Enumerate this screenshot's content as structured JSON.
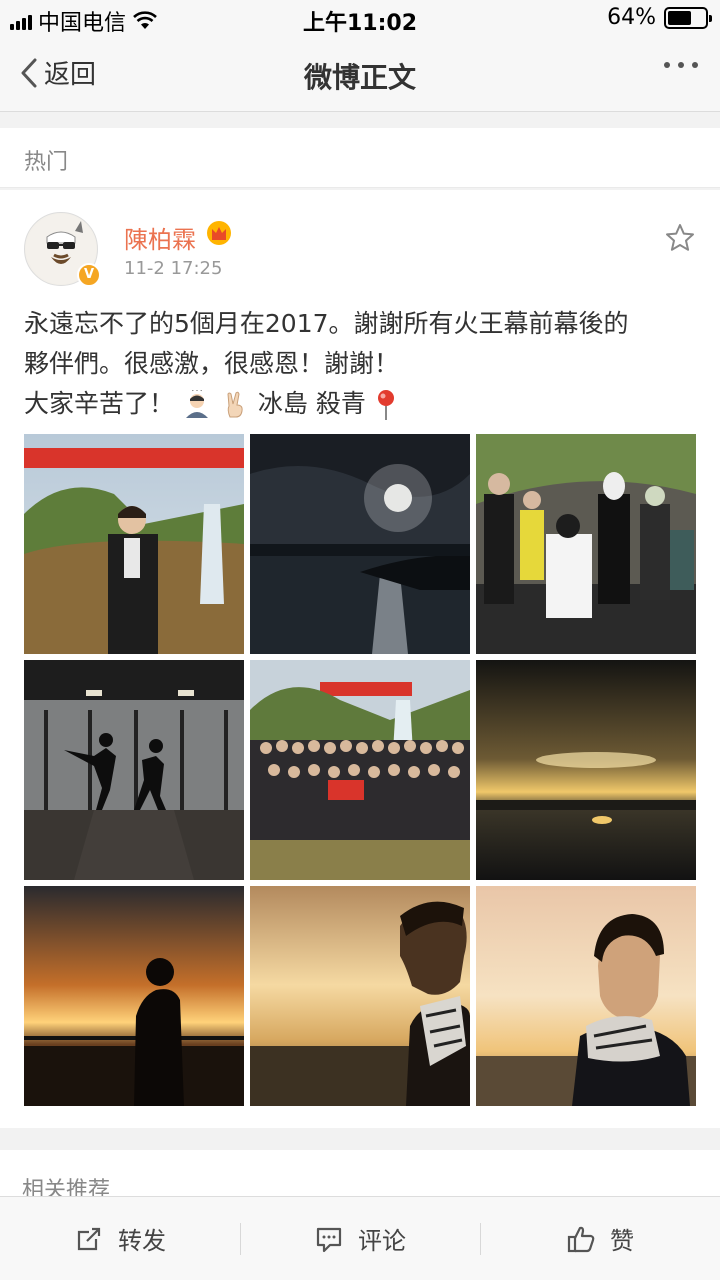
{
  "status": {
    "carrier": "中国电信",
    "time": "上午11:02",
    "battery": "64%",
    "battery_level": 0.64
  },
  "nav": {
    "back_label": "返回",
    "title": "微博正文"
  },
  "hot_label": "热门",
  "post": {
    "username": "陳柏霖",
    "time": "11-2 17:25",
    "text_line1": "永遠忘不了的5個月在2017。謝謝所有火王幕前幕後的",
    "text_line2": "夥伴們。很感激，很感恩！謝謝！",
    "text_line3_a": "大家辛苦了！",
    "text_line3_b": "冰島 殺青",
    "photos": [
      "photo-banner-waterfall",
      "photo-moon-over-sea",
      "photo-costumed-group",
      "photo-dance-silhouettes",
      "photo-crew-group",
      "photo-sunset-horizon",
      "photo-silhouette-sunset",
      "photo-profile-sunset",
      "photo-portrait-sunset"
    ]
  },
  "related_label": "相关推荐",
  "toolbar": {
    "repost": "转发",
    "comment": "评论",
    "like": "赞"
  },
  "colors": {
    "username": "#eb7350",
    "verified": "#f5a623"
  }
}
